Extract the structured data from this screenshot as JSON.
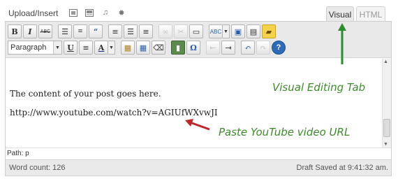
{
  "header": {
    "upload_label": "Upload/Insert",
    "media_icons": [
      "image-icon",
      "gallery-icon",
      "music-icon",
      "media-icon"
    ]
  },
  "tabs": [
    {
      "label": "Visual",
      "active": true
    },
    {
      "label": "HTML",
      "active": false
    }
  ],
  "toolbar": {
    "row1": [
      "bold-icon",
      "italic-icon",
      "strikethrough-icon",
      "bullet-list-icon",
      "numbered-list-icon",
      "blockquote-icon",
      "align-left-icon",
      "align-center-icon",
      "align-right-icon",
      "link-icon",
      "unlink-icon",
      "more-tag-icon",
      "spellcheck-icon",
      "fullscreen-icon",
      "kitchen-sink-icon",
      "note-icon"
    ],
    "format_select": "Paragraph",
    "row2": [
      "underline-icon",
      "justify-icon",
      "text-color-icon",
      "paste-text-icon",
      "paste-word-icon",
      "clear-formatting-icon",
      "embed-media-icon",
      "special-character-icon",
      "outdent-icon",
      "indent-icon",
      "undo-icon",
      "redo-icon",
      "help-icon"
    ]
  },
  "content": {
    "paragraphs": [
      "The content of your post goes here.",
      "http://www.youtube.com/watch?v=AGIUfWXvwJI"
    ]
  },
  "path_label": "Path: p",
  "status": {
    "word_count": "Word count: 126",
    "draft_saved": "Draft Saved at 9:41:32 am."
  },
  "annotations": {
    "visual_tab": "Visual Editing Tab",
    "paste_url": "Paste YouTube video URL"
  },
  "colors": {
    "annotation_green": "#3f8a2d",
    "arrow_red": "#c0272d",
    "arrow_green": "#2e8b2e"
  }
}
